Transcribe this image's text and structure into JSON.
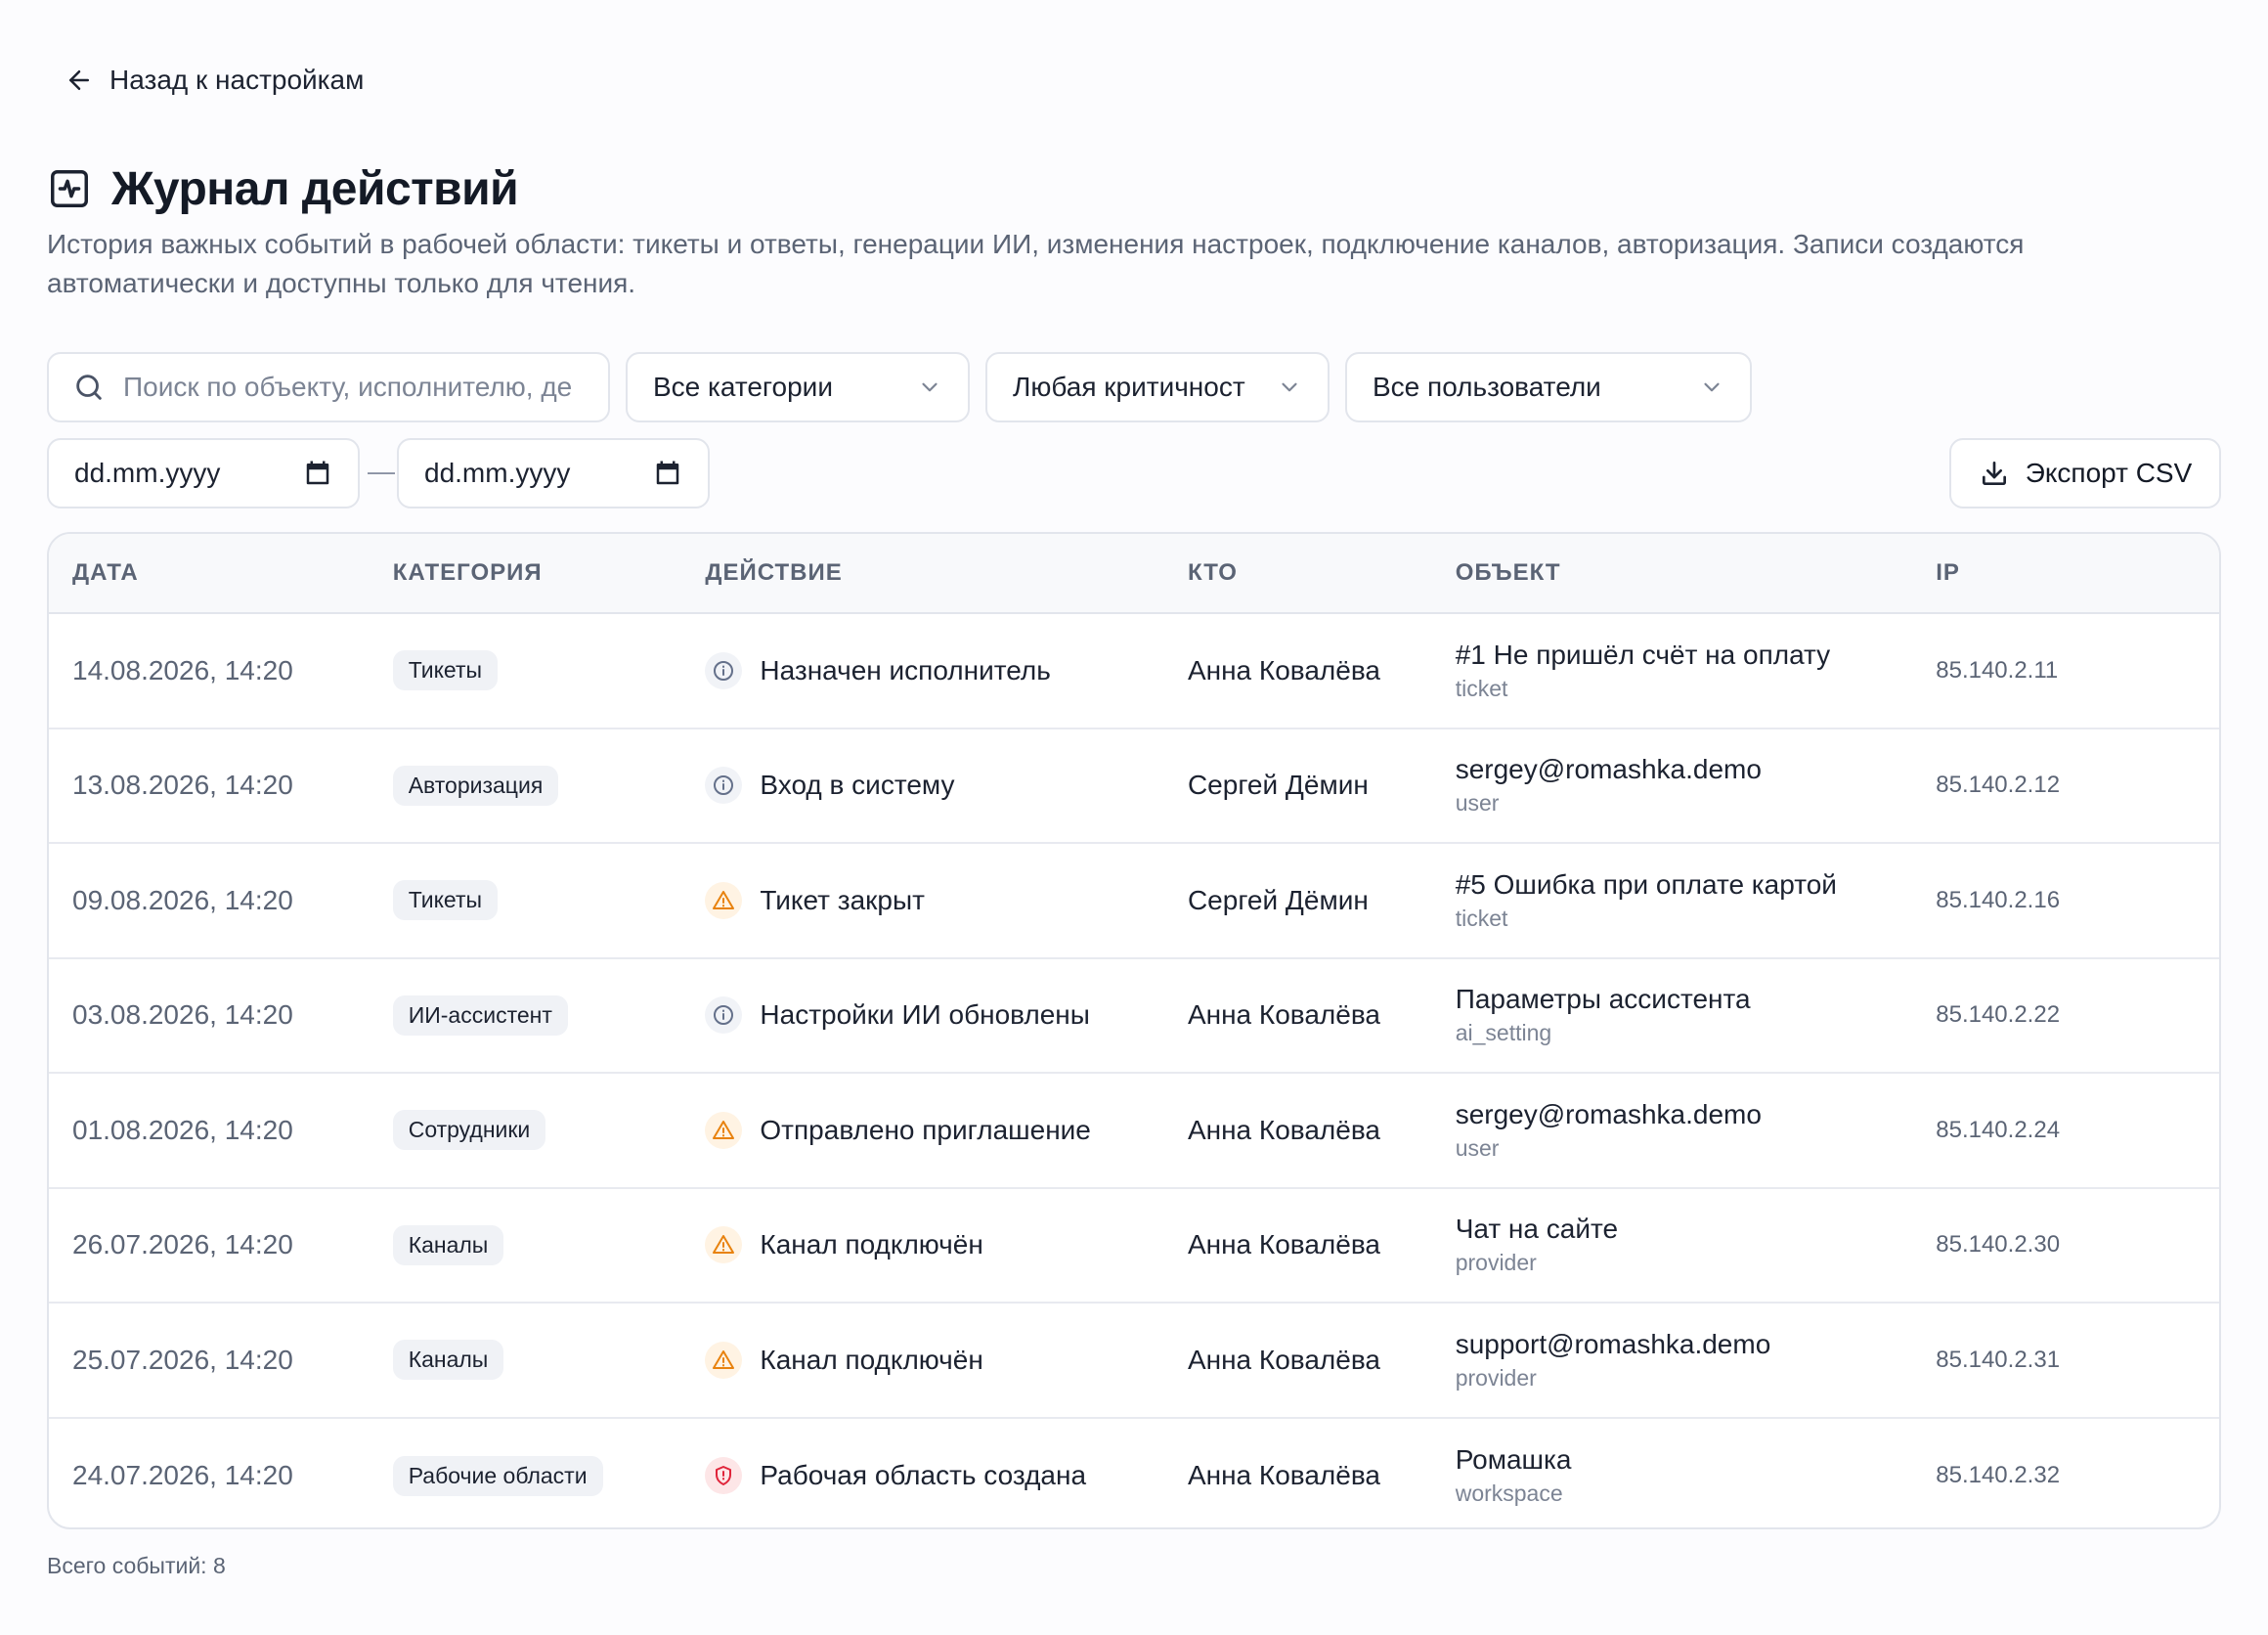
{
  "back_link": {
    "label": "Назад к настройкам",
    "icon": "arrow-left-icon"
  },
  "header": {
    "title": "Журнал действий",
    "icon": "activity-icon",
    "description": "История важных событий в рабочей области: тикеты и ответы, генерации ИИ, изменения настроек, подключение каналов, авторизация. Записи создаются автоматически и доступны только для чтения."
  },
  "filters": {
    "search_placeholder": "Поиск по объекту, исполнителю, де",
    "category": "Все категории",
    "severity": "Любая критичност",
    "user": "Все пользователи",
    "date_from": "dd.mm.yyyy",
    "date_separator": "—",
    "date_to": "dd.mm.yyyy",
    "export_label": "Экспорт CSV"
  },
  "table": {
    "columns": [
      "ДАТА",
      "КАТЕГОРИЯ",
      "ДЕЙСТВИЕ",
      "КТО",
      "ОБЪЕКТ",
      "IP"
    ],
    "rows": [
      {
        "date": "14.08.2026, 14:20",
        "category": "Тикеты",
        "severity": "info",
        "action": "Назначен исполнитель",
        "who": "Анна Ковалёва",
        "object": "#1 Не пришёл счёт на оплату",
        "object_type": "ticket",
        "ip": "85.140.2.11"
      },
      {
        "date": "13.08.2026, 14:20",
        "category": "Авторизация",
        "severity": "info",
        "action": "Вход в систему",
        "who": "Сергей Дёмин",
        "object": "sergey@romashka.demo",
        "object_type": "user",
        "ip": "85.140.2.12"
      },
      {
        "date": "09.08.2026, 14:20",
        "category": "Тикеты",
        "severity": "warning",
        "action": "Тикет закрыт",
        "who": "Сергей Дёмин",
        "object": "#5 Ошибка при оплате картой",
        "object_type": "ticket",
        "ip": "85.140.2.16"
      },
      {
        "date": "03.08.2026, 14:20",
        "category": "ИИ-ассистент",
        "severity": "info",
        "action": "Настройки ИИ обновлены",
        "who": "Анна Ковалёва",
        "object": "Параметры ассистента",
        "object_type": "ai_setting",
        "ip": "85.140.2.22"
      },
      {
        "date": "01.08.2026, 14:20",
        "category": "Сотрудники",
        "severity": "warning",
        "action": "Отправлено приглашение",
        "who": "Анна Ковалёва",
        "object": "sergey@romashka.demo",
        "object_type": "user",
        "ip": "85.140.2.24"
      },
      {
        "date": "26.07.2026, 14:20",
        "category": "Каналы",
        "severity": "warning",
        "action": "Канал подключён",
        "who": "Анна Ковалёва",
        "object": "Чат на сайте",
        "object_type": "provider",
        "ip": "85.140.2.30"
      },
      {
        "date": "25.07.2026, 14:20",
        "category": "Каналы",
        "severity": "warning",
        "action": "Канал подключён",
        "who": "Анна Ковалёва",
        "object": "support@romashka.demo",
        "object_type": "provider",
        "ip": "85.140.2.31"
      },
      {
        "date": "24.07.2026, 14:20",
        "category": "Рабочие области",
        "severity": "critical",
        "action": "Рабочая область создана",
        "who": "Анна Ковалёва",
        "object": "Ромашка",
        "object_type": "workspace",
        "ip": "85.140.2.32"
      }
    ]
  },
  "footer": {
    "total_label": "Всего событий: 8"
  },
  "colors": {
    "info": "#64708a",
    "warning": "#e8820e",
    "critical": "#e0243a",
    "text": "#1c2230",
    "muted": "#5b6475"
  }
}
